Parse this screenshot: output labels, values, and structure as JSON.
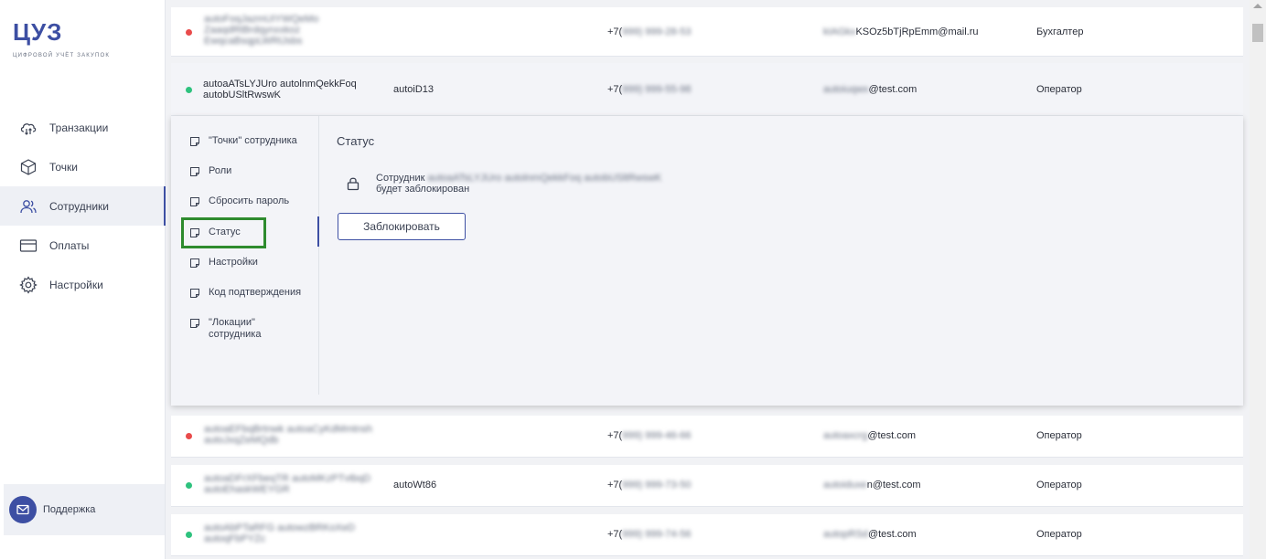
{
  "brand": {
    "logo": "ЦУЗ",
    "subtitle": "цифровой учёт закупок"
  },
  "nav": [
    {
      "label": "Транзакции",
      "icon": "cloud-transfer-icon",
      "active": false
    },
    {
      "label": "Точки",
      "icon": "box-icon",
      "active": false
    },
    {
      "label": "Сотрудники",
      "icon": "users-icon",
      "active": true
    },
    {
      "label": "Оплаты",
      "icon": "card-icon",
      "active": false
    },
    {
      "label": "Настройки",
      "icon": "gear-icon",
      "active": false
    }
  ],
  "support": {
    "label": "Поддержка",
    "icon": "mail-icon"
  },
  "colors": {
    "accent": "#3d4fa3",
    "red": "#e94b4b",
    "green": "#2ec27e",
    "highlight": "#2e8b2e"
  },
  "rows": [
    {
      "status": "red",
      "name": [
        "autoFoqJazmUIYWQeMo",
        "ZaaqdRtBrdqynxxkoz",
        "EwqcaBsqpLWRtJsbs"
      ],
      "name_blurred": true,
      "login": "",
      "phone_prefix": "+7(",
      "phone_rest": "999) 999-28-53",
      "email_blur": "kIAGkx",
      "email_clear": "KSOz5bTjRpEmm@mail.ru",
      "role": "Бухгалтер"
    },
    {
      "status": "green",
      "name": [
        "autoaATsLYJUro autolnmQekkFoq",
        "autobUSltRwswK"
      ],
      "name_blurred": false,
      "login": "autoiD13",
      "phone_prefix": "+7(",
      "phone_rest": "999) 999-55-98",
      "email_blur": "autoiuqwx",
      "email_clear": "@test.com",
      "role": "Оператор"
    },
    {
      "status": "red",
      "name": [
        "autoaEFbqBrtnwk autoaCyKdMmtnsh",
        "autoJxqZeMQdb"
      ],
      "name_blurred": true,
      "login": "",
      "phone_prefix": "+7(",
      "phone_rest": "999) 999-46-66",
      "email_blur": "autoaxcrg",
      "email_clear": "@test.com",
      "role": "Оператор"
    },
    {
      "status": "green",
      "name": [
        "autoaDFrXFbeqTR autoMKzPTvtbqD",
        "autoEhaskWEYGR"
      ],
      "name_blurred": true,
      "login": "autoWt86",
      "phone_prefix": "+7(",
      "phone_rest": "999) 999-73-50",
      "email_blur": "autoiduxe",
      "email_clear": "n@test.com",
      "role": "Оператор"
    },
    {
      "status": "green",
      "name": [
        "autoAbPTaRFG autowzBRKoXeD",
        "autoqFbPYZc"
      ],
      "name_blurred": true,
      "login": "",
      "phone_prefix": "+7(",
      "phone_rest": "999) 999-74-56",
      "email_blur": "autopRSd",
      "email_clear": "@test.com",
      "role": "Оператор"
    }
  ],
  "detail": {
    "menu": [
      {
        "label": "\"Точки\" сотрудника",
        "icon": "note-icon"
      },
      {
        "label": "Роли",
        "icon": "note-icon"
      },
      {
        "label": "Сбросить пароль",
        "icon": "note-icon"
      },
      {
        "label": "Статус",
        "icon": "note-icon",
        "active": true
      },
      {
        "label": "Настройки",
        "icon": "note-icon"
      },
      {
        "label": "Код подтверждения",
        "icon": "note-icon"
      },
      {
        "label": "\"Локации\"\nсотрудника",
        "icon": "note-icon"
      }
    ],
    "section_title": "Статус",
    "employee_prefix": "Сотрудник",
    "employee_name_blur": "autoaATsLYJUro autolnmQekkFoq autobUSltRwswK",
    "status_line2": "будет заблокирован",
    "block_button": "Заблокировать"
  }
}
